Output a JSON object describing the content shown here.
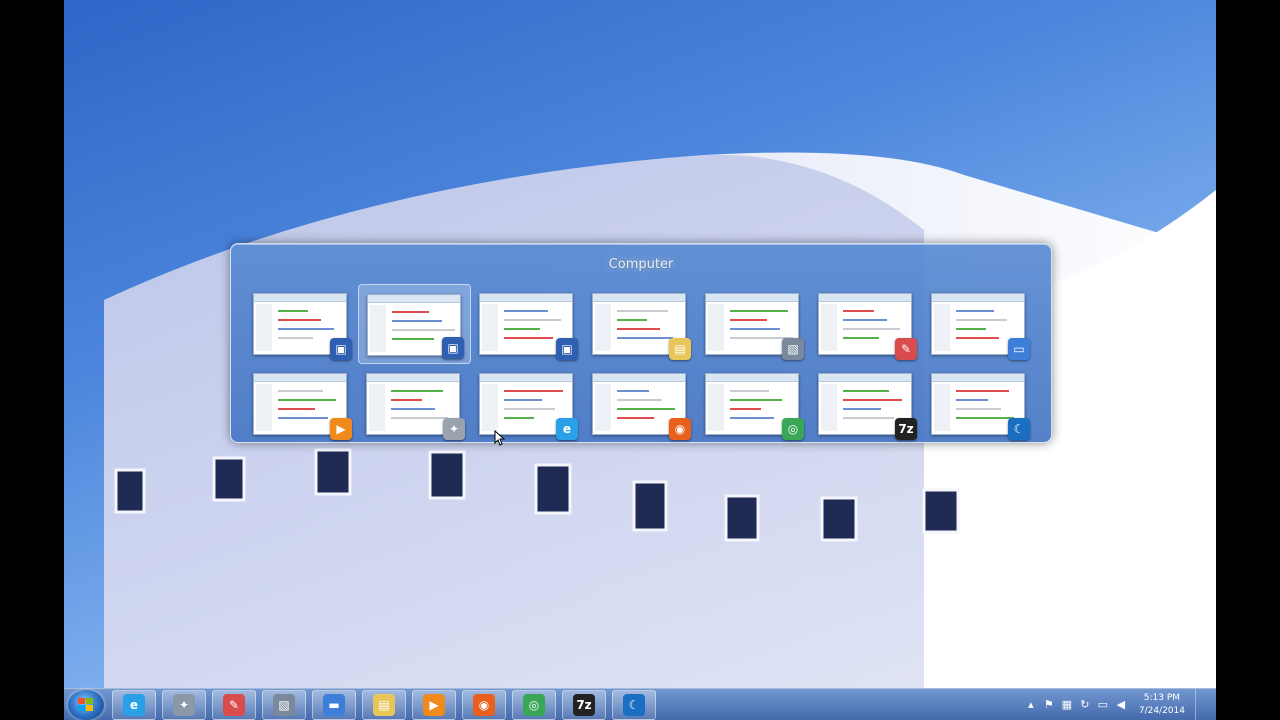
{
  "switcher": {
    "title": "Computer",
    "selected_index": 1,
    "row1": [
      {
        "app": "explorer",
        "icon": "computer-icon",
        "color": "#2f5fb0"
      },
      {
        "app": "explorer",
        "icon": "computer-icon",
        "color": "#2f5fb0"
      },
      {
        "app": "explorer",
        "icon": "computer-icon",
        "color": "#2f5fb0"
      },
      {
        "app": "explorer",
        "icon": "folder-icon",
        "color": "#e8c65a"
      },
      {
        "app": "virtualbox",
        "icon": "virtualbox-icon",
        "color": "#7a8a9c"
      },
      {
        "app": "paint",
        "icon": "paint-icon",
        "color": "#d94c4c"
      },
      {
        "app": "desktop",
        "icon": "desktop-icon",
        "color": "#3d7fd8"
      }
    ],
    "row2": [
      {
        "app": "media-player",
        "icon": "media-player-icon",
        "color": "#f08a1c"
      },
      {
        "app": "settings",
        "icon": "tools-icon",
        "color": "#9aa3ad"
      },
      {
        "app": "internet-explorer",
        "icon": "internet-explorer-icon",
        "color": "#2aa0e8"
      },
      {
        "app": "firefox",
        "icon": "firefox-icon",
        "color": "#e8601c"
      },
      {
        "app": "chrome",
        "icon": "chrome-icon",
        "color": "#3aa757"
      },
      {
        "app": "7zip",
        "icon": "7zip-icon",
        "color": "#222222",
        "label": "7z"
      },
      {
        "app": "mirrorop",
        "icon": "crescent-icon",
        "color": "#1b6fc2"
      }
    ]
  },
  "taskbar": {
    "buttons": [
      {
        "name": "internet-explorer",
        "icon": "internet-explorer-icon",
        "color": "#2aa0e8"
      },
      {
        "name": "control-tool",
        "icon": "tools-icon",
        "color": "#8c98a6"
      },
      {
        "name": "paint",
        "icon": "paint-icon",
        "color": "#d94c4c"
      },
      {
        "name": "virtualbox",
        "icon": "virtualbox-icon",
        "color": "#7a8a9c"
      },
      {
        "name": "remote-desktop",
        "icon": "monitor-icon",
        "color": "#3d7fd8"
      },
      {
        "name": "explorer",
        "icon": "folder-icon",
        "color": "#e8c65a"
      },
      {
        "name": "media-player",
        "icon": "media-player-icon",
        "color": "#f08a1c"
      },
      {
        "name": "firefox",
        "icon": "firefox-icon",
        "color": "#e8601c"
      },
      {
        "name": "chrome",
        "icon": "chrome-icon",
        "color": "#3aa757"
      },
      {
        "name": "7zip",
        "icon": "7zip-icon",
        "color": "#222222",
        "label": "7z"
      },
      {
        "name": "mirrorop",
        "icon": "crescent-icon",
        "color": "#1b6fc2"
      }
    ],
    "clock": {
      "time": "5:13 PM",
      "date": "7/24/2014"
    }
  }
}
